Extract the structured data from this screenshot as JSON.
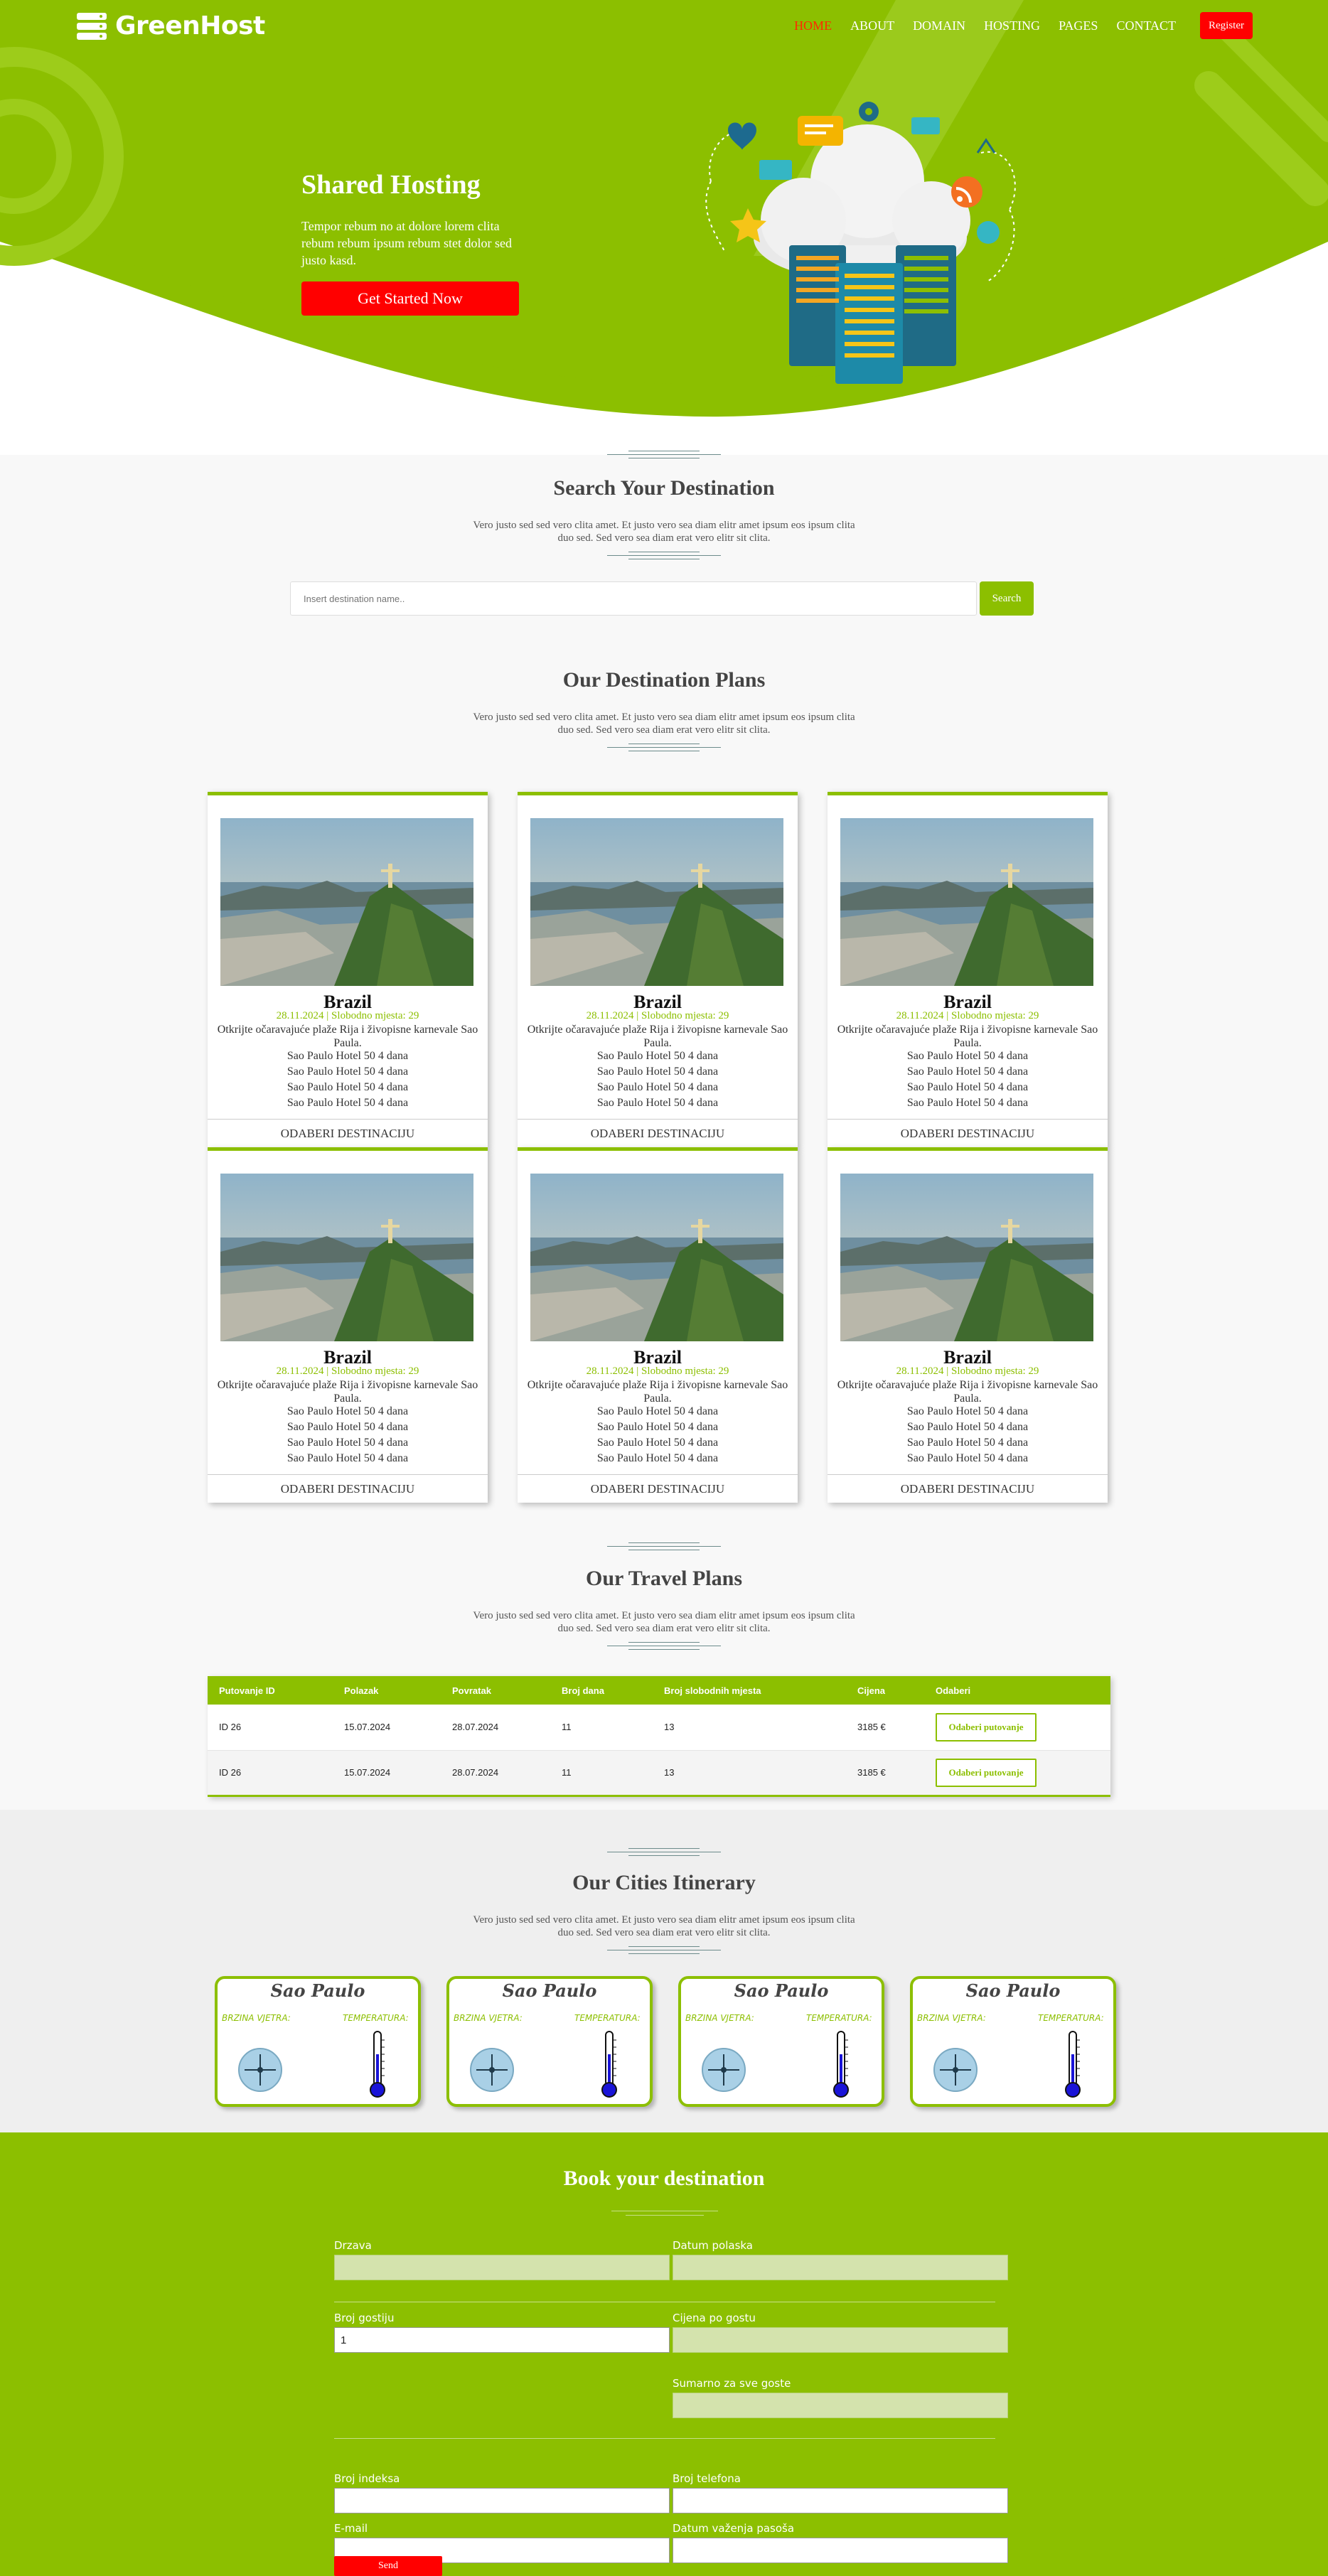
{
  "nav": {
    "brand": "GreenHost",
    "links": [
      "HOME",
      "ABOUT",
      "DOMAIN",
      "HOSTING",
      "PAGES",
      "CONTACT"
    ],
    "register": "Register"
  },
  "hero": {
    "title": "Shared Hosting",
    "text": "Tempor rebum no at dolore lorem clita rebum rebum ipsum rebum stet dolor sed justo kasd.",
    "cta": "Get Started Now"
  },
  "search": {
    "title": "Search Your Destination",
    "text": "Vero justo sed sed vero clita amet. Et justo vero sea diam elitr amet ipsum eos ipsum clita duo sed. Sed vero sea diam erat vero elitr sit clita.",
    "placeholder": "Insert destination name..",
    "button": "Search"
  },
  "destinations": {
    "title": "Our Destination Plans",
    "text": "Vero justo sed sed vero clita amet. Et justo vero sea diam elitr amet ipsum eos ipsum clita duo sed. Sed vero sea diam erat vero elitr sit clita.",
    "cards": [
      {
        "name": "Brazil",
        "meta": "28.11.2024 | Slobodno mjesta: 29",
        "desc": "Otkrijte očaravajuće plaže Rija i živopisne karnevale Sao Paula.",
        "hotels": [
          "Sao Paulo Hotel 50 4 dana",
          "Sao Paulo Hotel 50 4 dana",
          "Sao Paulo Hotel 50 4 dana",
          "Sao Paulo Hotel 50 4 dana"
        ],
        "button": "ODABERI DESTINACIJU"
      },
      {
        "name": "Brazil",
        "meta": "28.11.2024 | Slobodno mjesta: 29",
        "desc": "Otkrijte očaravajuće plaže Rija i živopisne karnevale Sao Paula.",
        "hotels": [
          "Sao Paulo Hotel 50 4 dana",
          "Sao Paulo Hotel 50 4 dana",
          "Sao Paulo Hotel 50 4 dana",
          "Sao Paulo Hotel 50 4 dana"
        ],
        "button": "ODABERI DESTINACIJU"
      },
      {
        "name": "Brazil",
        "meta": "28.11.2024 | Slobodno mjesta: 29",
        "desc": "Otkrijte očaravajuće plaže Rija i živopisne karnevale Sao Paula.",
        "hotels": [
          "Sao Paulo Hotel 50 4 dana",
          "Sao Paulo Hotel 50 4 dana",
          "Sao Paulo Hotel 50 4 dana",
          "Sao Paulo Hotel 50 4 dana"
        ],
        "button": "ODABERI DESTINACIJU"
      },
      {
        "name": "Brazil",
        "meta": "28.11.2024 | Slobodno mjesta: 29",
        "desc": "Otkrijte očaravajuće plaže Rija i živopisne karnevale Sao Paula.",
        "hotels": [
          "Sao Paulo Hotel 50 4 dana",
          "Sao Paulo Hotel 50 4 dana",
          "Sao Paulo Hotel 50 4 dana",
          "Sao Paulo Hotel 50 4 dana"
        ],
        "button": "ODABERI DESTINACIJU"
      },
      {
        "name": "Brazil",
        "meta": "28.11.2024 | Slobodno mjesta: 29",
        "desc": "Otkrijte očaravajuće plaže Rija i živopisne karnevale Sao Paula.",
        "hotels": [
          "Sao Paulo Hotel 50 4 dana",
          "Sao Paulo Hotel 50 4 dana",
          "Sao Paulo Hotel 50 4 dana",
          "Sao Paulo Hotel 50 4 dana"
        ],
        "button": "ODABERI DESTINACIJU"
      },
      {
        "name": "Brazil",
        "meta": "28.11.2024 | Slobodno mjesta: 29",
        "desc": "Otkrijte očaravajuće plaže Rija i živopisne karnevale Sao Paula.",
        "hotels": [
          "Sao Paulo Hotel 50 4 dana",
          "Sao Paulo Hotel 50 4 dana",
          "Sao Paulo Hotel 50 4 dana",
          "Sao Paulo Hotel 50 4 dana"
        ],
        "button": "ODABERI DESTINACIJU"
      }
    ]
  },
  "travel": {
    "title": "Our Travel Plans",
    "text": "Vero justo sed sed vero clita amet. Et justo vero sea diam elitr amet ipsum eos ipsum clita duo sed. Sed vero sea diam erat vero elitr sit clita.",
    "headers": [
      "Putovanje ID",
      "Polazak",
      "Povratak",
      "Broj dana",
      "Broj slobodnih mjesta",
      "Cijena",
      "Odaberi"
    ],
    "rows": [
      [
        "ID 26",
        "15.07.2024",
        "28.07.2024",
        "11",
        "13",
        "3185 €",
        "Odaberi putovanje"
      ],
      [
        "ID 26",
        "15.07.2024",
        "28.07.2024",
        "11",
        "13",
        "3185 €",
        "Odaberi putovanje"
      ]
    ]
  },
  "cities": {
    "title": "Our Cities Itinerary",
    "text": "Vero justo sed sed vero clita amet. Et justo vero sea diam elitr amet ipsum eos ipsum clita duo sed. Sed vero sea diam erat vero elitr sit clita.",
    "items": [
      {
        "name": "Sao Paulo",
        "wind": "BRZINA VJETRA:",
        "temp": "TEMPERATURA:"
      },
      {
        "name": "Sao Paulo",
        "wind": "BRZINA VJETRA:",
        "temp": "TEMPERATURA:"
      },
      {
        "name": "Sao Paulo",
        "wind": "BRZINA VJETRA:",
        "temp": "TEMPERATURA:"
      },
      {
        "name": "Sao Paulo",
        "wind": "BRZINA VJETRA:",
        "temp": "TEMPERATURA:"
      }
    ]
  },
  "booking": {
    "title": "Book your destination",
    "drzava": "Drzava",
    "datum_polaska": "Datum polaska",
    "broj_gostiju": "Broj gostiju",
    "broj_gostiju_value": "1",
    "cijena_po_gostu": "Cijena po gostu",
    "sumarno": "Sumarno za sve goste",
    "broj_indeksa": "Broj indeksa",
    "broj_telefona": "Broj telefona",
    "email": "E-mail",
    "datum_pasosa": "Datum važenja pasoša",
    "send": "Send"
  },
  "colors": {
    "accent": "#8cbf00",
    "danger": "#ff0000"
  }
}
